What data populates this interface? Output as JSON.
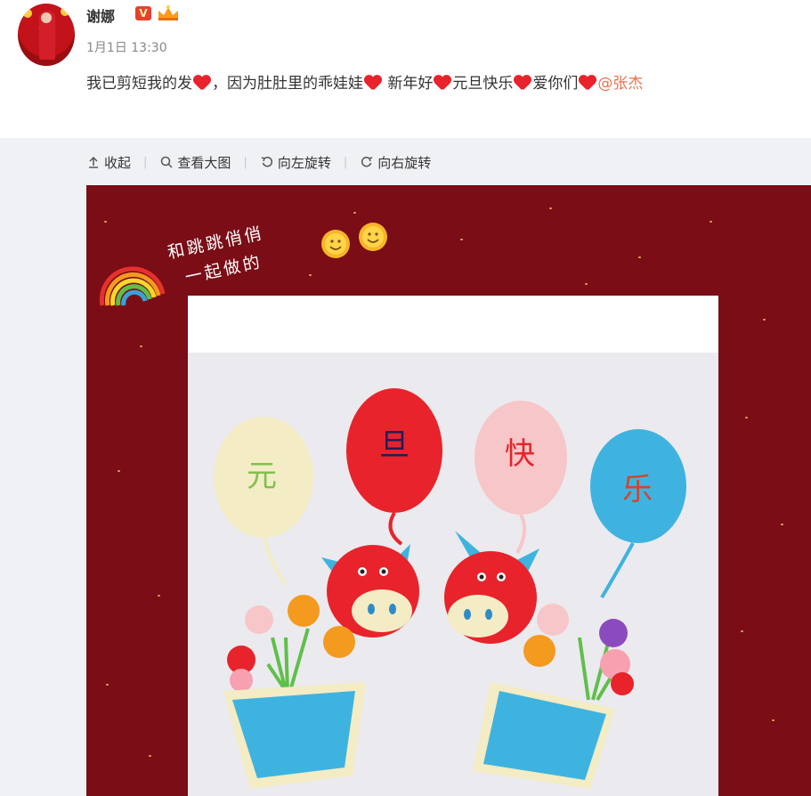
{
  "user": {
    "name": "谢娜",
    "verified_badge": "V",
    "time": "1月1日 13:30"
  },
  "post": {
    "seg1": "我已剪短我的发",
    "seg2": "，因为肚肚里的乖娃娃",
    "seg3": " 新年好",
    "seg4": "元旦快乐",
    "seg5": "爱你们",
    "mention": "@张杰"
  },
  "toolbar": {
    "collapse": "收起",
    "view_large": "查看大图",
    "rotate_left": "向左旋转",
    "rotate_right": "向右旋转"
  },
  "photo": {
    "handwriting_line1": "和跳跳俏俏",
    "handwriting_line2": "一起做的",
    "balloon1": "元",
    "balloon2": "旦",
    "balloon3": "快",
    "balloon4": "乐"
  },
  "colors": {
    "accent": "#eb7350",
    "photo_bg": "#7a0d16",
    "heart": "#e8232b"
  }
}
